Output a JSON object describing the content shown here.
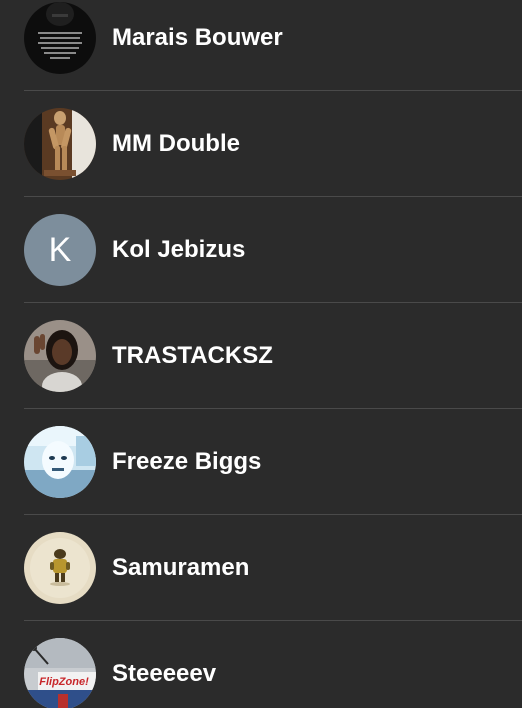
{
  "contacts": [
    {
      "name": "Marais Bouwer",
      "avatar": "quote-poster-avatar",
      "avatar_text": "THAT THE JEWS THAT SEE CONNECT THE ... HIMSELF"
    },
    {
      "name": "MM Double",
      "avatar": "wooden-mannequin-avatar"
    },
    {
      "name": "Kol Jebizus",
      "avatar": "letter-avatar",
      "initial": "K",
      "color": "#7d8e9c"
    },
    {
      "name": "TRASTACKSZ",
      "avatar": "selfie-avatar"
    },
    {
      "name": "Freeze Biggs",
      "avatar": "inverted-photo-avatar"
    },
    {
      "name": "Samuramen",
      "avatar": "figurine-avatar"
    },
    {
      "name": "Steeeeev",
      "avatar": "flipzone-sign-avatar",
      "avatar_text": "FlipZone!"
    }
  ]
}
